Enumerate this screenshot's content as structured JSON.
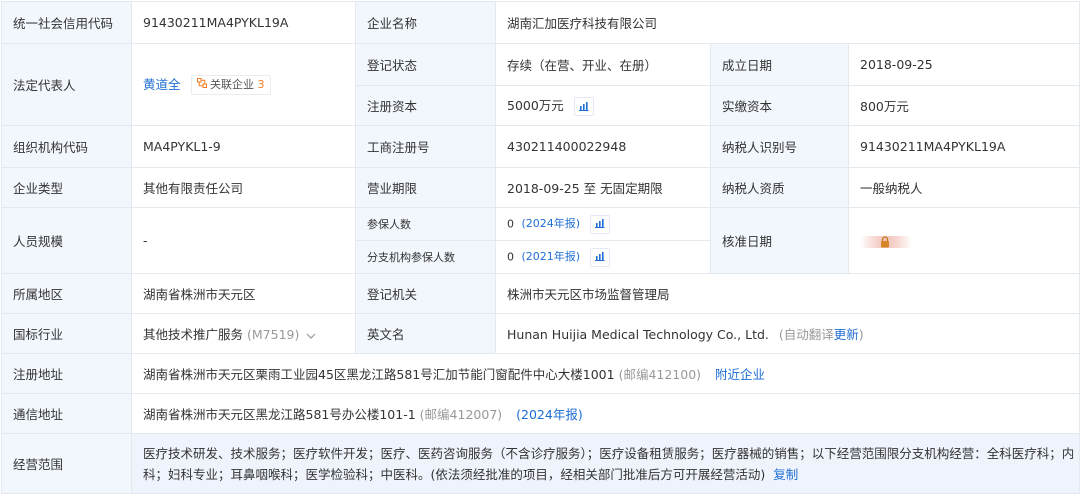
{
  "rows": {
    "credit_code": {
      "label": "统一社会信用代码",
      "value": "91430211MA4PYKL19A"
    },
    "company_name": {
      "label": "企业名称",
      "value": "湖南汇加医疗科技有限公司"
    },
    "legal_rep": {
      "label": "法定代表人",
      "name": "黄道全",
      "related_label": "关联企业",
      "related_count": "3"
    },
    "reg_status": {
      "label": "登记状态",
      "value": "存续（在营、开业、在册）"
    },
    "established": {
      "label": "成立日期",
      "value": "2018-09-25"
    },
    "reg_capital": {
      "label": "注册资本",
      "value": "5000万元"
    },
    "paid_capital": {
      "label": "实缴资本",
      "value": "800万元"
    },
    "org_code": {
      "label": "组织机构代码",
      "value": "MA4PYKL1-9"
    },
    "biz_reg_no": {
      "label": "工商注册号",
      "value": "430211400022948"
    },
    "taxpayer_id": {
      "label": "纳税人识别号",
      "value": "91430211MA4PYKL19A"
    },
    "company_type": {
      "label": "企业类型",
      "value": "其他有限责任公司"
    },
    "biz_term": {
      "label": "营业期限",
      "value": "2018-09-25 至 无固定期限"
    },
    "taxpayer_qual": {
      "label": "纳税人资质",
      "value": "一般纳税人"
    },
    "staff_size": {
      "label": "人员规模",
      "value": "-"
    },
    "insured": {
      "label": "参保人数",
      "value": "0",
      "report": "(2024年报)"
    },
    "branch_insured": {
      "label": "分支机构参保人数",
      "value": "0",
      "report": "(2021年报)"
    },
    "approval_date": {
      "label": "核准日期"
    },
    "region": {
      "label": "所属地区",
      "value": "湖南省株洲市天元区"
    },
    "reg_authority": {
      "label": "登记机关",
      "value": "株洲市天元区市场监督管理局"
    },
    "industry": {
      "label": "国标行业",
      "value": "其他技术推广服务",
      "code": "(M7519)"
    },
    "english_name": {
      "label": "英文名",
      "value": "Hunan Huijia Medical Technology Co., Ltd.",
      "note": "(自动翻译",
      "update": "更新",
      "close": ")"
    },
    "reg_address": {
      "label": "注册地址",
      "value": "湖南省株洲市天元区栗雨工业园45区黑龙江路581号汇加节能门窗配件中心大楼1001",
      "postcode": "(邮编412100)",
      "nearby": "附近企业"
    },
    "mail_address": {
      "label": "通信地址",
      "value": "湖南省株洲市天元区黑龙江路581号办公楼101-1",
      "postcode": "(邮编412007)",
      "report": "(2024年报)"
    },
    "biz_scope": {
      "label": "经营范围",
      "value": "医疗技术研发、技术服务；医疗软件开发；医疗、医药咨询服务（不含诊疗服务）；医疗设备租赁服务；医疗器械的销售；以下经营范围限分支机构经营：全科医疗科；内科；妇科专业；耳鼻咽喉科；医学检验科；中医科。(依法须经批准的项目，经相关部门批准后方可开展经营活动)",
      "copy": "复制"
    }
  },
  "colors": {
    "label_bg": "#f2f6fd",
    "link": "#1f6ed4",
    "accent_orange": "#f27c22",
    "border": "#e4e8ef"
  }
}
